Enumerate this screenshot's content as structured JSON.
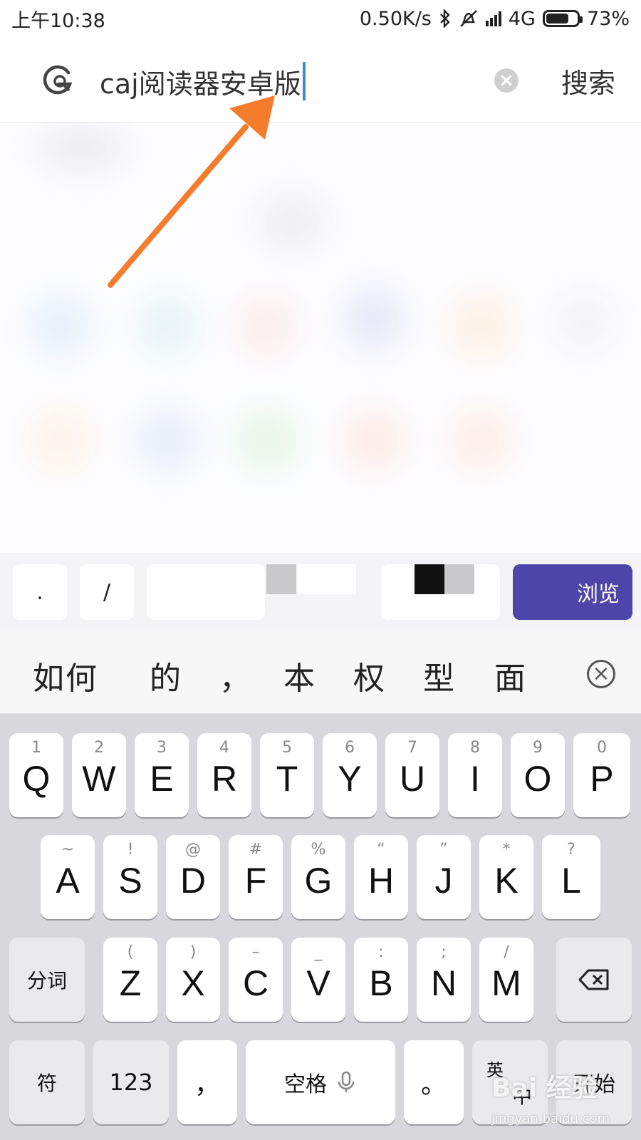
{
  "status_bar": {
    "time": "上午10:38",
    "speed": "0.50K/s",
    "network": "4G",
    "battery": "73%",
    "battery_level": 0.73
  },
  "search": {
    "query": "caj阅读器安卓版",
    "submit_label": "搜索",
    "clear_label": "×"
  },
  "quick_strip": {
    "dot": ".",
    "slash": "/",
    "browse_label": "浏览"
  },
  "candidates": [
    "如何",
    "的",
    "，",
    "本",
    "权",
    "型",
    "面"
  ],
  "keyboard": {
    "row1": [
      {
        "letter": "Q",
        "sub": "1"
      },
      {
        "letter": "W",
        "sub": "2"
      },
      {
        "letter": "E",
        "sub": "3"
      },
      {
        "letter": "R",
        "sub": "4"
      },
      {
        "letter": "T",
        "sub": "5"
      },
      {
        "letter": "Y",
        "sub": "6"
      },
      {
        "letter": "U",
        "sub": "7"
      },
      {
        "letter": "I",
        "sub": "8"
      },
      {
        "letter": "O",
        "sub": "9"
      },
      {
        "letter": "P",
        "sub": "0"
      }
    ],
    "row2": [
      {
        "letter": "A",
        "sub": "~"
      },
      {
        "letter": "S",
        "sub": "!"
      },
      {
        "letter": "D",
        "sub": "@"
      },
      {
        "letter": "F",
        "sub": "#"
      },
      {
        "letter": "G",
        "sub": "%"
      },
      {
        "letter": "H",
        "sub": "“"
      },
      {
        "letter": "J",
        "sub": "”"
      },
      {
        "letter": "K",
        "sub": "*"
      },
      {
        "letter": "L",
        "sub": "?"
      }
    ],
    "row3": [
      {
        "letter": "Z",
        "sub": "("
      },
      {
        "letter": "X",
        "sub": ")"
      },
      {
        "letter": "C",
        "sub": "–"
      },
      {
        "letter": "V",
        "sub": "_"
      },
      {
        "letter": "B",
        "sub": ":"
      },
      {
        "letter": "N",
        "sub": ";"
      },
      {
        "letter": "M",
        "sub": "/"
      }
    ],
    "segment_label": "分词",
    "symbols_label": "符",
    "numbers_label": "123",
    "comma_label": "，",
    "space_label": "空格",
    "period_label": "。",
    "lang_top": "英",
    "lang_bottom": "中",
    "go_label": "开始"
  },
  "watermark": {
    "text": "Bai 经验",
    "url": "jingyan.baidu.com"
  },
  "colors": {
    "arrow": "#f47c2a",
    "caret": "#3f89d6",
    "browse_button": "#4e45a8",
    "keyboard_bg": "#d8d8dc"
  },
  "icons": {
    "search_engine": "g-search-icon",
    "clear": "clear-circle-icon",
    "mic": "microphone-icon",
    "backspace": "backspace-icon",
    "close": "close-circle-icon",
    "bluetooth": "bluetooth-icon",
    "mute": "mute-bell-icon",
    "signal": "signal-icon",
    "battery": "battery-icon"
  }
}
